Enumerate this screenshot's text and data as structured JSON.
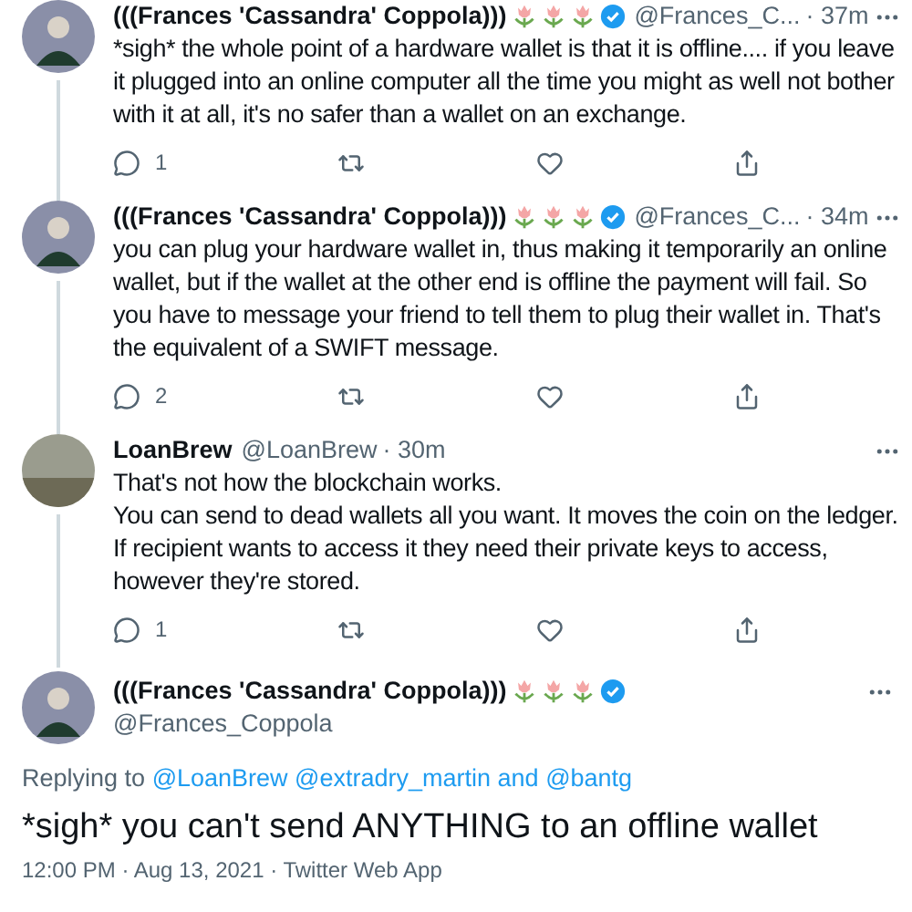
{
  "replies": [
    {
      "kind": "frances",
      "name": "(((Frances 'Cassandra' Coppola)))",
      "verified": true,
      "handle": "@Frances_C...",
      "time": "· 37m",
      "text": "*sigh* the whole point of a hardware wallet is that it is offline.... if you leave it plugged into an online computer all the time you might as well not bother with it at all, it's no safer than a wallet on an exchange.",
      "reply_count": "1"
    },
    {
      "kind": "frances",
      "name": "(((Frances 'Cassandra' Coppola)))",
      "verified": true,
      "handle": "@Frances_C...",
      "time": "· 34m",
      "text": "you can plug your hardware wallet in, thus making it temporarily an online wallet, but if the wallet at the other end is offline the payment will fail. So you have to message your friend to tell them to plug their wallet in. That's the equivalent of a SWIFT message.",
      "reply_count": "2"
    },
    {
      "kind": "loanbrew",
      "name": "LoanBrew",
      "verified": false,
      "handle": "@LoanBrew",
      "time": "· 30m",
      "text": "That's not how the blockchain works.\nYou can send to dead wallets all you want. It moves the coin on the ledger.\nIf recipient wants to access it they need their private keys to access, however they're stored.",
      "reply_count": "1"
    }
  ],
  "main": {
    "kind": "frances",
    "name": "(((Frances 'Cassandra' Coppola)))",
    "verified": true,
    "handle": "@Frances_Coppola",
    "replying_prefix": "Replying to",
    "replying_to": "@LoanBrew @extradry_martin and @bantg",
    "text": "*sigh* you can't send ANYTHING to an offline wallet",
    "timestamp": "12:00 PM · Aug 13, 2021 · Twitter Web App"
  }
}
